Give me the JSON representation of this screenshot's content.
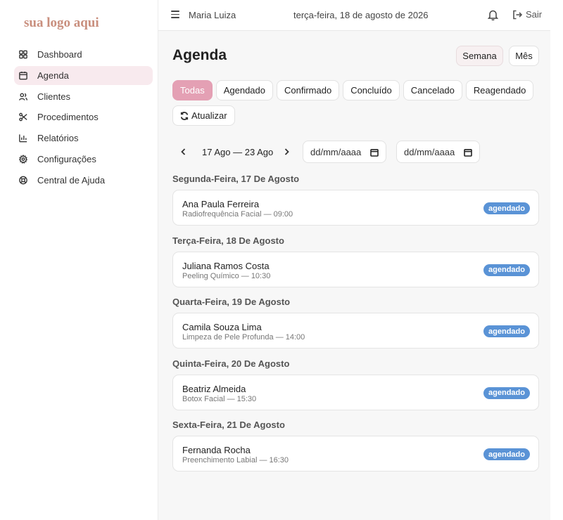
{
  "brand": {
    "logo_text": "sua logo aqui",
    "accent": "#e4a0b4"
  },
  "sidebar": {
    "items": [
      {
        "label": "Dashboard",
        "icon": "grid-icon"
      },
      {
        "label": "Agenda",
        "icon": "calendar-icon",
        "active": true
      },
      {
        "label": "Clientes",
        "icon": "users-icon"
      },
      {
        "label": "Procedimentos",
        "icon": "scissors-icon"
      },
      {
        "label": "Relatórios",
        "icon": "bar-chart-icon"
      },
      {
        "label": "Configurações",
        "icon": "gear-icon"
      },
      {
        "label": "Central de Ajuda",
        "icon": "lifebuoy-icon"
      }
    ]
  },
  "topbar": {
    "user_name": "Maria Luiza",
    "date": "terça-feira, 18 de agosto de 2026",
    "logout_label": "Sair"
  },
  "page": {
    "title": "Agenda",
    "view_week": "Semana",
    "view_month": "Mês"
  },
  "filters": [
    "Todas",
    "Agendado",
    "Confirmado",
    "Concluído",
    "Cancelado",
    "Reagendado"
  ],
  "refresh_label": "Atualizar",
  "range": {
    "label": "17 Ago — 23 Ago",
    "start_placeholder": "dd/mm/aaaa",
    "end_placeholder": "dd/mm/aaaa"
  },
  "days": [
    {
      "title": "Segunda-Feira, 17 De Agosto",
      "name": "Ana Paula Ferreira",
      "detail": "Radiofrequência Facial — 09:00",
      "status": "agendado"
    },
    {
      "title": "Terça-Feira, 18 De Agosto",
      "name": "Juliana Ramos Costa",
      "detail": "Peeling Químico — 10:30",
      "status": "agendado"
    },
    {
      "title": "Quarta-Feira, 19 De Agosto",
      "name": "Camila Souza Lima",
      "detail": "Limpeza de Pele Profunda — 14:00",
      "status": "agendado"
    },
    {
      "title": "Quinta-Feira, 20 De Agosto",
      "name": "Beatriz Almeida",
      "detail": "Botox Facial — 15:30",
      "status": "agendado"
    },
    {
      "title": "Sexta-Feira, 21 De Agosto",
      "name": "Fernanda Rocha",
      "detail": "Preenchimento Labial — 16:30",
      "status": "agendado"
    }
  ]
}
